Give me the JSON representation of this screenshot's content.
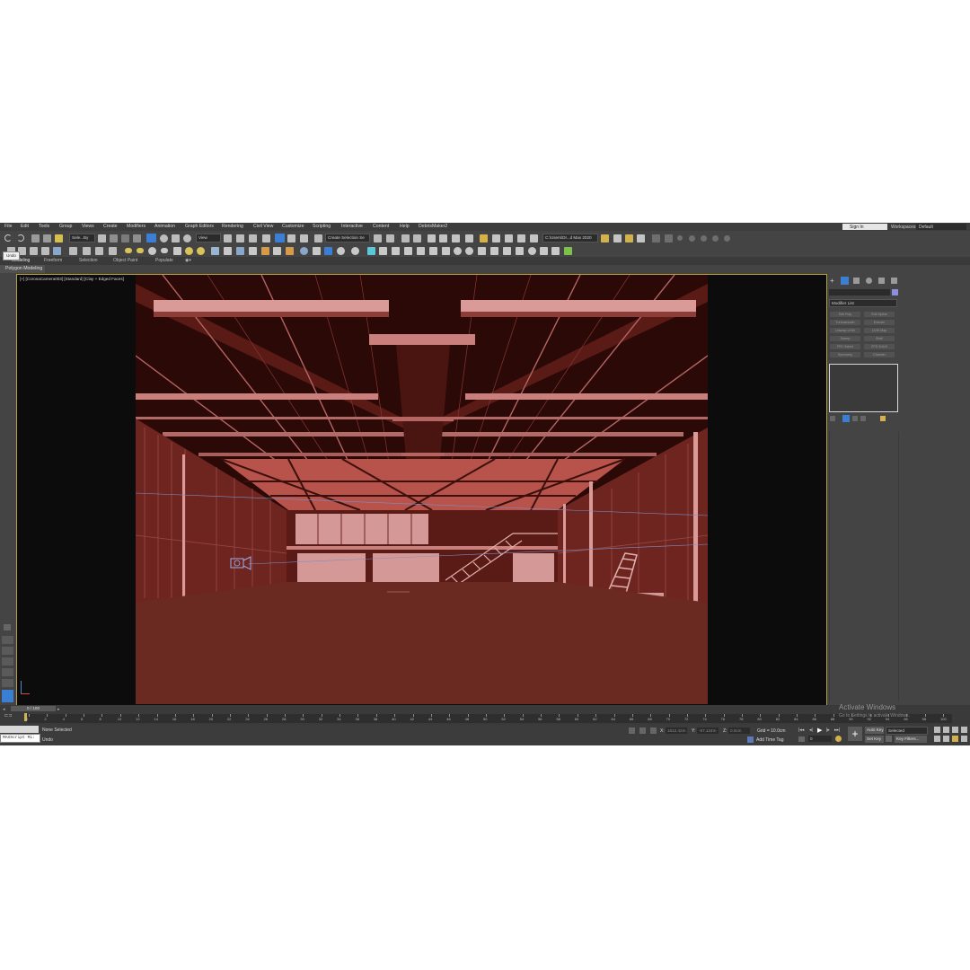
{
  "menu": [
    "File",
    "Edit",
    "Tools",
    "Group",
    "Views",
    "Create",
    "Modifiers",
    "Animation",
    "Graph Editors",
    "Rendering",
    "Civil View",
    "Customize",
    "Scripting",
    "Interactive",
    "Content",
    "Help",
    "DebrisMaker2"
  ],
  "account": {
    "sign_in": "Sign In",
    "workspaces_label": "Workspaces:",
    "workspace": "Default"
  },
  "toolbar": {
    "selection_filter": "Sele...By",
    "ref_coord": "View",
    "named_selection": "Create Selection Se",
    "project_path": "C:\\Users\\Dr...d Max 2020"
  },
  "ribbon": {
    "tabs": [
      "Modeling",
      "Freeform",
      "Selection",
      "Object Paint",
      "Populate"
    ],
    "panel": "Polygon Modeling"
  },
  "tooltip": "Undo",
  "viewport": {
    "label": "[+] [CoronaCamera003] [Standard] [Clay + Edged Faces]"
  },
  "command_panel": {
    "modifier_list": "Modifier List",
    "buttons": [
      "Edit Poly",
      "Edit Spline",
      "Turbosmooth",
      "Extrude",
      "Unwrap UVW",
      "UVW Map",
      "Sweep",
      "Shell",
      "FFD Select",
      "FFD 3x3x3",
      "Symmetry",
      "Chamfer"
    ]
  },
  "timeline": {
    "frame": "0 / 100",
    "ticks": [
      "0",
      "2",
      "4",
      "6",
      "8",
      "10",
      "12",
      "14",
      "16",
      "18",
      "20",
      "22",
      "24",
      "26",
      "28",
      "30",
      "32",
      "34",
      "36",
      "38",
      "40",
      "42",
      "44",
      "46",
      "48",
      "50",
      "52",
      "54",
      "56",
      "58",
      "60",
      "62",
      "64",
      "66",
      "68",
      "70",
      "72",
      "74",
      "76",
      "78",
      "80",
      "82",
      "84",
      "86",
      "88",
      "90",
      "92",
      "94",
      "96",
      "98",
      "100"
    ]
  },
  "status": {
    "script": "MAXScript Mi:",
    "selection": "None Selected",
    "prompt": "Undo",
    "x_label": "X:",
    "x_val": "1812.42m",
    "y_label": "Y:",
    "y_val": "-97.124m",
    "z_label": "Z:",
    "z_val": "0.0cm",
    "grid": "Grid = 10.0cm",
    "add_time_tag": "Add Time Tag",
    "auto_key": "Auto Key",
    "set_key": "Set Key",
    "key_selected": "Selected",
    "key_filters": "Key Filters...",
    "frame_field": "0"
  },
  "watermark": {
    "title": "Activate Windows",
    "subtitle": "Go to Settings to activate Windows."
  },
  "colors": {
    "accent_blue": "#3b7fd4",
    "viewport_border": "#b8a042",
    "scene_dark": "#2b0907",
    "scene_mid": "#6e2520",
    "scene_light": "#d99a98"
  }
}
